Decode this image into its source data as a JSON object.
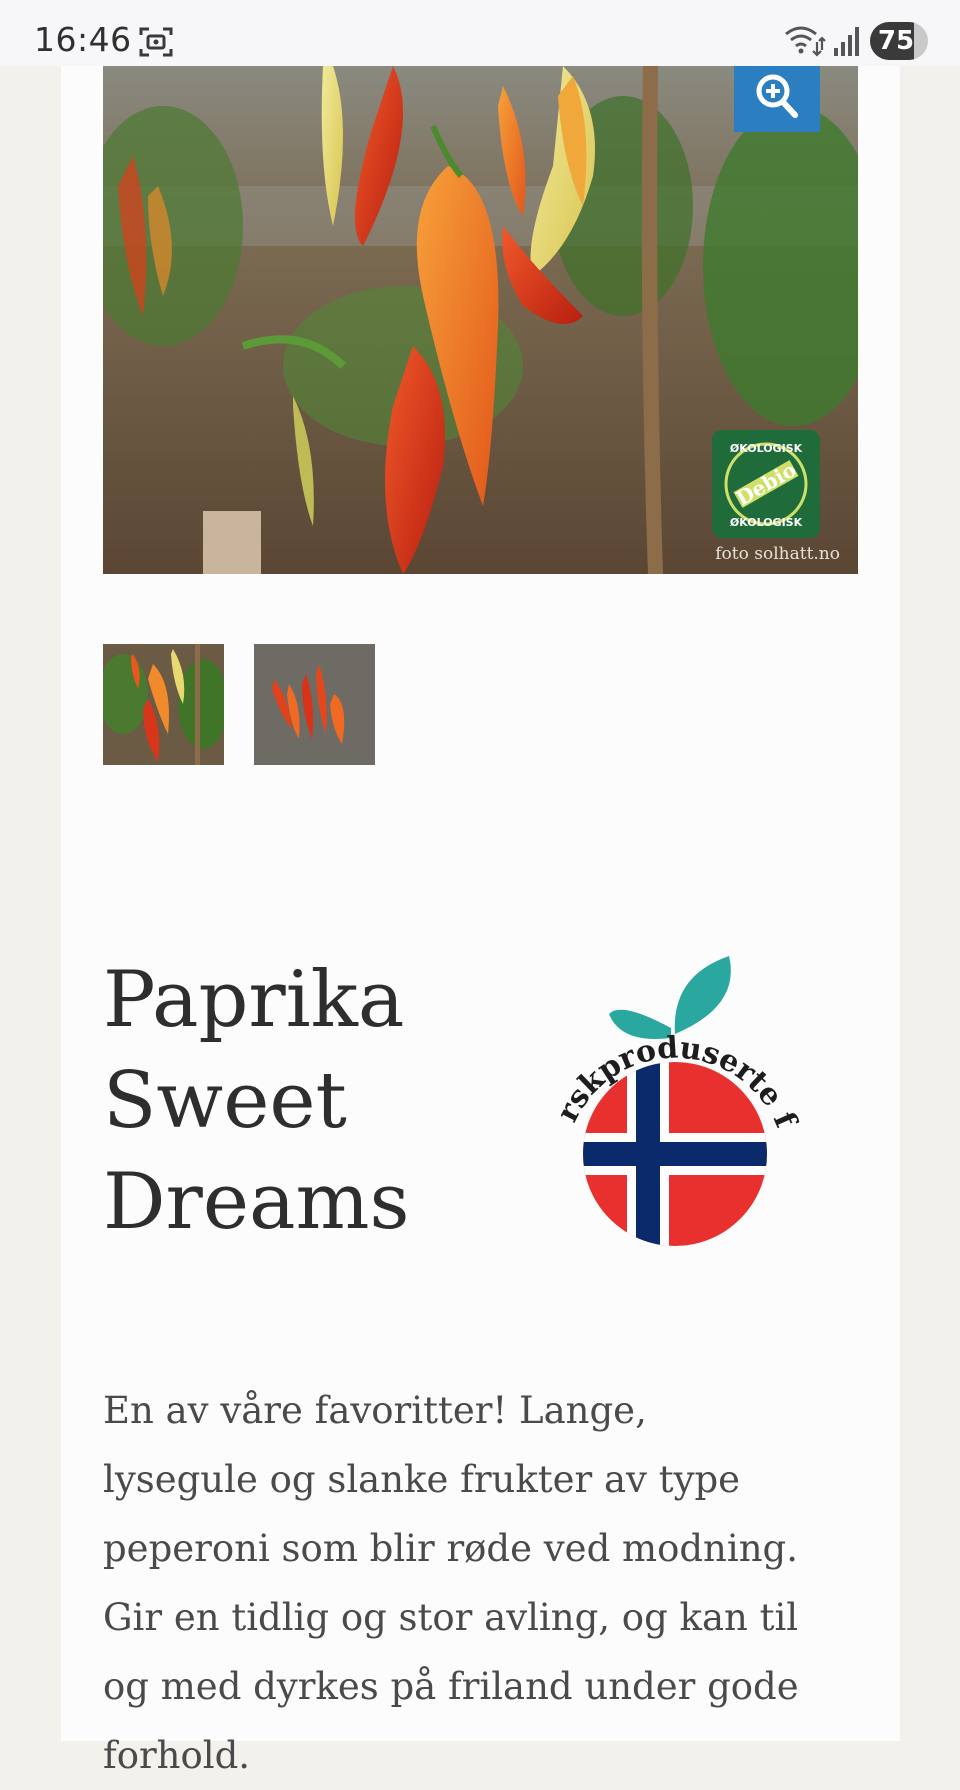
{
  "status_bar": {
    "time": "16:46",
    "battery": "75",
    "battery_level": 0.75,
    "icons": [
      "screenshot-icon",
      "wifi-icon",
      "signal-icon"
    ]
  },
  "gallery": {
    "photo_credit": "foto solhatt.no",
    "badge_top": "ØKOLOGISK",
    "badge_center": "Debio",
    "badge_bottom": "ØKOLOGISK",
    "zoom_icon": "zoom-in-icon",
    "thumbnails": [
      "thumbnail-plant",
      "thumbnail-harvest"
    ]
  },
  "product": {
    "title": "Paprika Sweet Dreams",
    "logo_text": "norskproduserte frø",
    "description": "En av våre favoritter! Lange, lysegule og slanke frukter av type peperoni som blir røde ved modning. Gir en tidlig og stor avling, og kan til og med dyrkes på friland under gode forhold."
  },
  "colors": {
    "zoom_button": "#2b7fc0",
    "badge_green": "#1f6b3a",
    "logo_leaf": "#2aa8a0",
    "flag_red": "#e8312f",
    "flag_blue": "#0a2a6b"
  }
}
